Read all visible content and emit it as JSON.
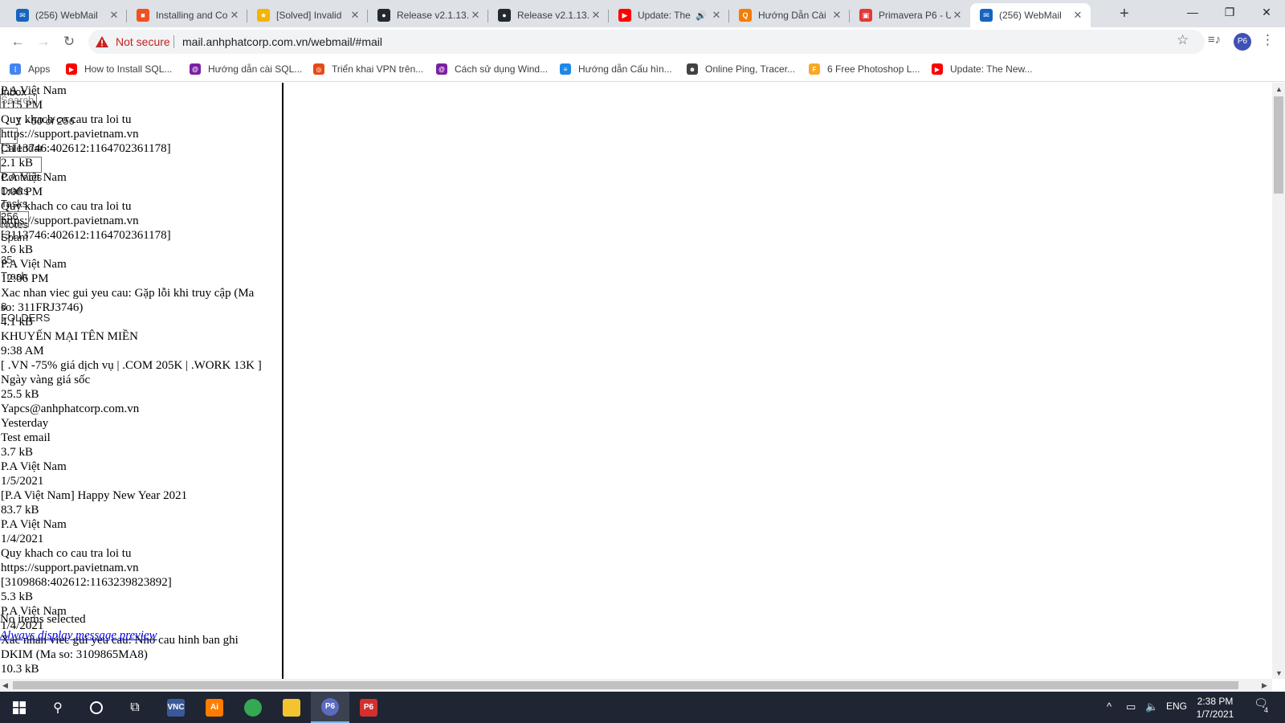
{
  "tabs": [
    {
      "title": "(256) WebMail",
      "favicon_color": "#1565c0",
      "favicon_glyph": "✉"
    },
    {
      "title": "Installing and Co",
      "favicon_color": "#f25022",
      "favicon_glyph": "■"
    },
    {
      "title": "[Solved] Invalid",
      "favicon_color": "#f4b400",
      "favicon_glyph": "★"
    },
    {
      "title": "Release v2.1.13.",
      "favicon_color": "#24292e",
      "favicon_glyph": "●"
    },
    {
      "title": "Release v2.1.13.",
      "favicon_color": "#24292e",
      "favicon_glyph": "●"
    },
    {
      "title": "Update: The",
      "favicon_color": "#ff0000",
      "favicon_glyph": "▶"
    },
    {
      "title": "Hướng Dẫn Cài",
      "favicon_color": "#f57c00",
      "favicon_glyph": "Q"
    },
    {
      "title": "Primavera P6 - U",
      "favicon_color": "#e53935",
      "favicon_glyph": "▣"
    },
    {
      "title": "(256) WebMail",
      "favicon_color": "#1565c0",
      "favicon_glyph": "✉"
    }
  ],
  "browser": {
    "security_label": "Not secure",
    "url": "mail.anhphatcorp.com.vn/webmail/#mail",
    "profile_initials": "P6"
  },
  "bookmarks": [
    {
      "label": "Apps",
      "color": "#4285f4",
      "glyph": "⋮"
    },
    {
      "label": "How to Install SQL...",
      "color": "#ff0000",
      "glyph": "▶"
    },
    {
      "label": "Hướng dẫn cài SQL...",
      "color": "#7b1fa2",
      "glyph": "@"
    },
    {
      "label": "Triển khai VPN trên...",
      "color": "#e64a19",
      "glyph": "◎"
    },
    {
      "label": "Cách sử dụng Wind...",
      "color": "#7b1fa2",
      "glyph": "@"
    },
    {
      "label": "Hướng dẫn Cấu hìn...",
      "color": "#1e88e5",
      "glyph": "≡"
    },
    {
      "label": "Online Ping, Tracer...",
      "color": "#424242",
      "glyph": "☻"
    },
    {
      "label": "6 Free Photoshop L...",
      "color": "#f9a825",
      "glyph": "F"
    },
    {
      "label": "Update: The New...",
      "color": "#ff0000",
      "glyph": "▶"
    }
  ],
  "mail_lines": [
    "P.A Việt Nam",
    "1:15 PM",
    "Quy khach co cau tra loi tu",
    "https://support.pavietnam.vn",
    "[3113746:402612:1164702361178]",
    "2.1 kB",
    "P.A Việt Nam",
    "1:06 PM",
    "Quy khach co cau tra loi tu",
    "https://support.pavietnam.vn",
    "[3113746:402612:1164702361178]",
    "3.6 kB",
    "P.A Việt Nam",
    "12:06 PM",
    "Xac nhan viec gui yeu cau: Gặp lỗi khi truy cập (Ma",
    "so: 311FRJ3746)",
    "4.1 kB",
    "KHUYẾN MẠI TÊN MIỀN",
    "9:38 AM",
    "[ .VN -75% giá dịch vụ | .COM 205K | .WORK 13K ]",
    "Ngày vàng giá sốc",
    "25.5 kB",
    "Yapcs@anhphatcorp.com.vn",
    "Yesterday",
    "Test email",
    "3.7 kB",
    "P.A Việt Nam",
    "1/5/2021",
    "[P.A Việt Nam] Happy New Year 2021",
    "83.7 kB",
    "P.A Việt Nam",
    "1/4/2021",
    "Quy khach co cau tra loi tu",
    "https://support.pavietnam.vn",
    "[3109868:402612:1163239823892]",
    "5.3 kB",
    "P.A Việt Nam",
    "1/4/2021",
    "Xac nhan viec gui yeu cau: Nho cau hinh ban ghi",
    "DKIM (Ma so: 3109865MA8)",
    "10.3 kB"
  ],
  "overlay": {
    "search_placeholder": "Search",
    "count_text": "1 - 50 of 256",
    "nav_items": [
      {
        "label": "Inbox"
      },
      {
        "label": "Calendar"
      },
      {
        "label": "Contacts"
      },
      {
        "label": "Drafts"
      },
      {
        "label": "Tasks"
      },
      {
        "label": "Notes"
      },
      {
        "label": "Spam"
      },
      {
        "label": "Trash"
      }
    ],
    "folder_counts": [
      "256",
      "35",
      "8"
    ],
    "folders_label": "FOLDERS"
  },
  "status": {
    "no_items": "No items selected",
    "preview_link": "Always display message preview"
  },
  "taskbar": {
    "apps": [
      {
        "name": "vnc",
        "label": "VNC",
        "color": "#3b5998"
      },
      {
        "name": "illustrator",
        "label": "Ai",
        "color": "#ff7c00"
      },
      {
        "name": "chrome",
        "label": "",
        "color": "#34a853"
      },
      {
        "name": "explorer",
        "label": "",
        "color": "#f4c430"
      },
      {
        "name": "chrome-profile",
        "label": "P6",
        "color": "#5c6bc0"
      },
      {
        "name": "p6",
        "label": "P6",
        "color": "#d32f2f"
      }
    ],
    "language": "ENG",
    "time": "2:38 PM",
    "date": "1/7/2021",
    "notification_count": "4"
  }
}
